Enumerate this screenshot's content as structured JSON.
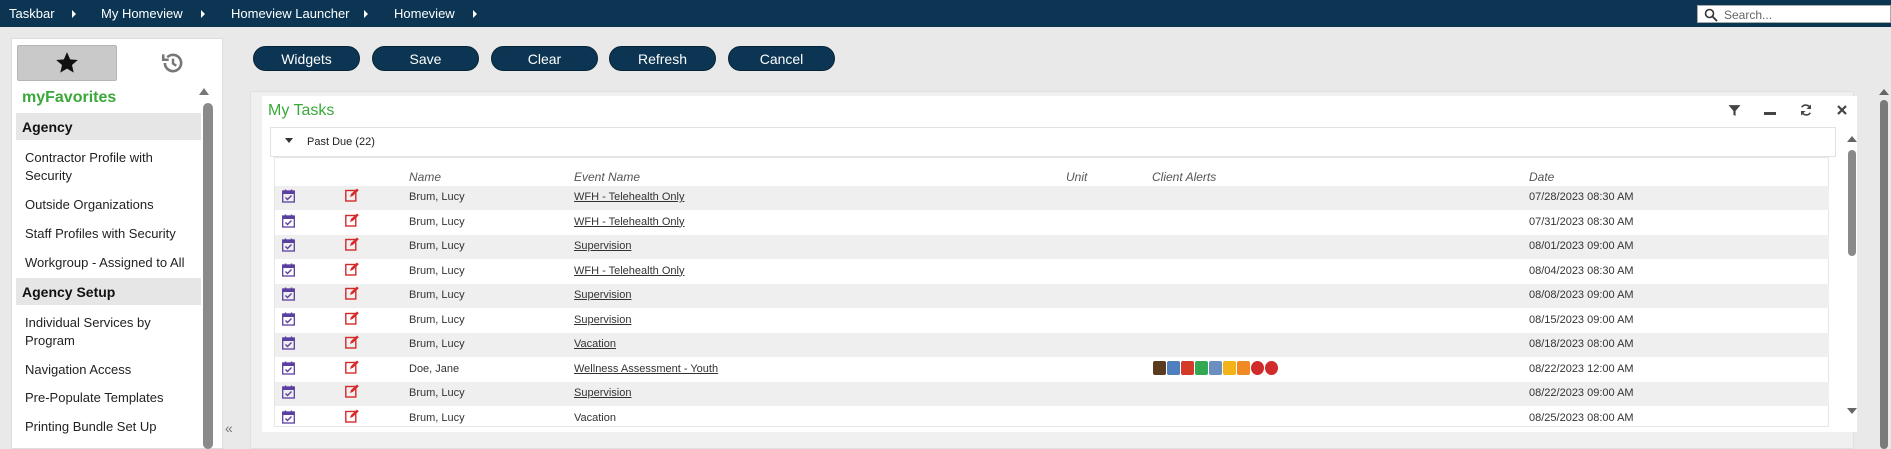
{
  "breadcrumbs": [
    "Taskbar",
    "My Homeview",
    "Homeview Launcher",
    "Homeview"
  ],
  "search": {
    "placeholder": "Search..."
  },
  "sidebar": {
    "tabs": [
      {
        "icon": "star-icon",
        "active": true
      },
      {
        "icon": "history-icon",
        "active": false
      }
    ],
    "title": "myFavorites",
    "sections": [
      {
        "label": "Agency",
        "items": [
          "Contractor Profile with Security",
          "Outside Organizations",
          "Staff Profiles with Security",
          "Workgroup - Assigned to All"
        ]
      },
      {
        "label": "Agency Setup",
        "items": [
          "Individual Services by Program",
          "Navigation Access",
          "Pre-Populate Templates",
          "Printing Bundle Set Up"
        ]
      }
    ]
  },
  "toolbar": {
    "widgets_label": "Widgets",
    "save_label": "Save",
    "clear_label": "Clear",
    "refresh_label": "Refresh",
    "cancel_label": "Cancel"
  },
  "widget": {
    "title": "My Tasks",
    "group_label": "Past Due (22)",
    "columns": {
      "name": "Name",
      "event": "Event Name",
      "unit": "Unit",
      "alerts": "Client Alerts",
      "date": "Date"
    },
    "rows": [
      {
        "name": "Brum, Lucy",
        "event": "WFH - Telehealth Only",
        "link": true,
        "date": "07/28/2023 08:30 AM"
      },
      {
        "name": "Brum, Lucy",
        "event": "WFH - Telehealth Only",
        "link": true,
        "date": "07/31/2023 08:30 AM"
      },
      {
        "name": "Brum, Lucy",
        "event": "Supervision",
        "link": true,
        "date": "08/01/2023 09:00 AM"
      },
      {
        "name": "Brum, Lucy",
        "event": "WFH - Telehealth Only",
        "link": true,
        "date": "08/04/2023 08:30 AM"
      },
      {
        "name": "Brum, Lucy",
        "event": "Supervision",
        "link": true,
        "date": "08/08/2023 09:00 AM"
      },
      {
        "name": "Brum, Lucy",
        "event": "Supervision",
        "link": true,
        "date": "08/15/2023 09:00 AM"
      },
      {
        "name": "Brum, Lucy",
        "event": "Vacation",
        "link": true,
        "date": "08/18/2023 08:00 AM"
      },
      {
        "name": "Doe, Jane",
        "event": "Wellness Assessment - Youth",
        "link": true,
        "date": "08/22/2023 12:00 AM",
        "alerts": true
      },
      {
        "name": "Brum, Lucy",
        "event": "Supervision",
        "link": true,
        "date": "08/22/2023 09:00 AM"
      },
      {
        "name": "Brum, Lucy",
        "event": "Vacation",
        "link": false,
        "date": "08/25/2023 08:00 AM"
      }
    ],
    "alert_colors": [
      "#5a3b20",
      "#4f7fbf",
      "#d23b2a",
      "#33a852",
      "#6b8fbf",
      "#f2b418",
      "#f08a24",
      "#d12a2a",
      "#d12a2a"
    ]
  },
  "colors": {
    "brand": "#0b3552",
    "accent_green": "#3aa83a",
    "icon_purple": "#5a3fa0",
    "icon_red": "#d42a2a"
  }
}
